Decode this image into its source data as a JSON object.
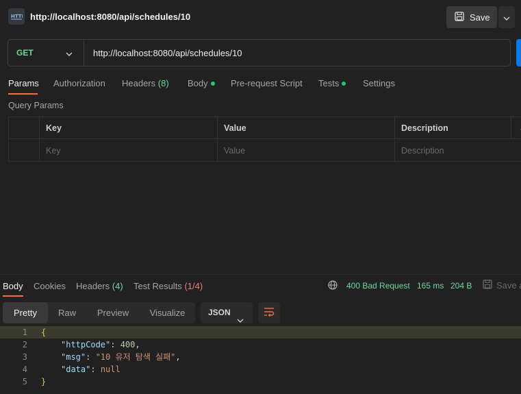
{
  "request": {
    "title": "http://localhost:8080/api/schedules/10",
    "method": "GET",
    "url": "http://localhost:8080/api/schedules/10",
    "save_label": "Save"
  },
  "request_tabs": [
    {
      "label": "Params",
      "active": true
    },
    {
      "label": "Authorization"
    },
    {
      "label": "Headers",
      "count": "(8)"
    },
    {
      "label": "Body",
      "dot": true
    },
    {
      "label": "Pre-request Script"
    },
    {
      "label": "Tests",
      "dot": true
    },
    {
      "label": "Settings"
    }
  ],
  "query_params": {
    "section_label": "Query Params",
    "columns": [
      "Key",
      "Value",
      "Description"
    ],
    "placeholders": [
      "Key",
      "Value",
      "Description"
    ]
  },
  "response": {
    "tabs": [
      {
        "label": "Body",
        "active": true
      },
      {
        "label": "Cookies"
      },
      {
        "label": "Headers",
        "count": "(4)"
      },
      {
        "label": "Test Results",
        "count": "(1/4)"
      }
    ],
    "status": "400 Bad Request",
    "time": "165 ms",
    "size": "204 B",
    "save_label": "Save a",
    "views": [
      "Pretty",
      "Raw",
      "Preview",
      "Visualize"
    ],
    "format": "JSON",
    "body_lines": [
      {
        "num": "1",
        "text": "{"
      },
      {
        "num": "2",
        "key": "\"httpCode\"",
        "value": "400",
        "trail": ","
      },
      {
        "num": "3",
        "key": "\"msg\"",
        "value": "\"10 유저 탐색 실패\"",
        "trail": ","
      },
      {
        "num": "4",
        "key": "\"data\"",
        "value": "null",
        "trail": ""
      },
      {
        "num": "5",
        "text": "}"
      }
    ]
  },
  "colors": {
    "accent": "#ff6c37",
    "success": "#6bdd9a",
    "error": "#f27c72",
    "send": "#097bed"
  },
  "icons": [
    "http-icon",
    "save-icon",
    "chevron-down-icon",
    "globe-icon",
    "wrap-lines-icon",
    "more-icon"
  ]
}
